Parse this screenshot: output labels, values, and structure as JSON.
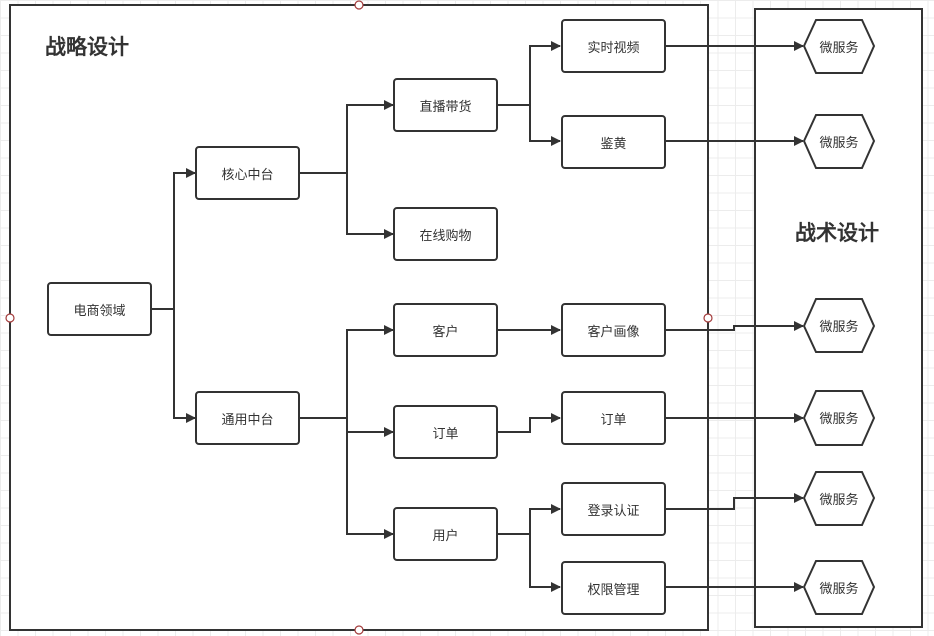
{
  "strategic_frame": {
    "title": "战略设计"
  },
  "tactical_frame": {
    "title": "战术设计"
  },
  "nodes": {
    "root": "电商领域",
    "core": "核心中台",
    "common": "通用中台",
    "live": "直播带货",
    "online": "在线购物",
    "customer": "客户",
    "order": "订单",
    "user": "用户",
    "video": "实时视频",
    "porn": "鉴黄",
    "portrait": "客户画像",
    "order2": "订单",
    "login": "登录认证",
    "perm": "权限管理"
  },
  "microservices": [
    "微服务",
    "微服务",
    "微服务",
    "微服务",
    "微服务",
    "微服务"
  ],
  "colors": {
    "stroke": "#333333",
    "handle": "#a33a3a",
    "grid": "#ececec"
  }
}
